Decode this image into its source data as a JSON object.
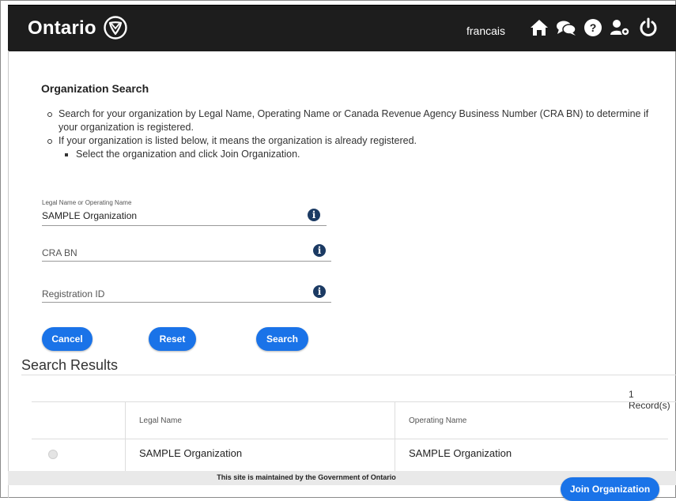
{
  "header": {
    "brand": "Ontario",
    "language_link": "francais",
    "icons": [
      "home-icon",
      "chat-icon",
      "help-icon",
      "user-settings-icon",
      "power-icon"
    ]
  },
  "page": {
    "title": "Organization Search",
    "instructions": [
      "Search for your organization by Legal Name, Operating Name or Canada Revenue Agency Business Number (CRA BN) to determine if your organization is registered.",
      "If your organization is listed below, it means the organization is already registered."
    ],
    "sub_instruction": "Select the organization and click Join Organization."
  },
  "form": {
    "legal_name": {
      "label": "Legal Name or Operating Name",
      "value": "SAMPLE Organization"
    },
    "cra_bn": {
      "placeholder": "CRA BN"
    },
    "registration_id": {
      "placeholder": "Registration ID"
    },
    "buttons": {
      "cancel": "Cancel",
      "reset": "Reset",
      "search": "Search"
    }
  },
  "results": {
    "title": "Search Results",
    "record_count": "1 Record(s)",
    "columns": [
      "",
      "Legal Name",
      "Operating Name"
    ],
    "rows": [
      {
        "legal_name": "SAMPLE Organization",
        "operating_name": "SAMPLE Organization"
      }
    ]
  },
  "footer": {
    "text": "This site is maintained by the Government of Ontario",
    "join_button": "Join Organization"
  },
  "colors": {
    "topbar": "#1d1d1d",
    "accent": "#1a73e8",
    "info": "#1b3a63"
  }
}
